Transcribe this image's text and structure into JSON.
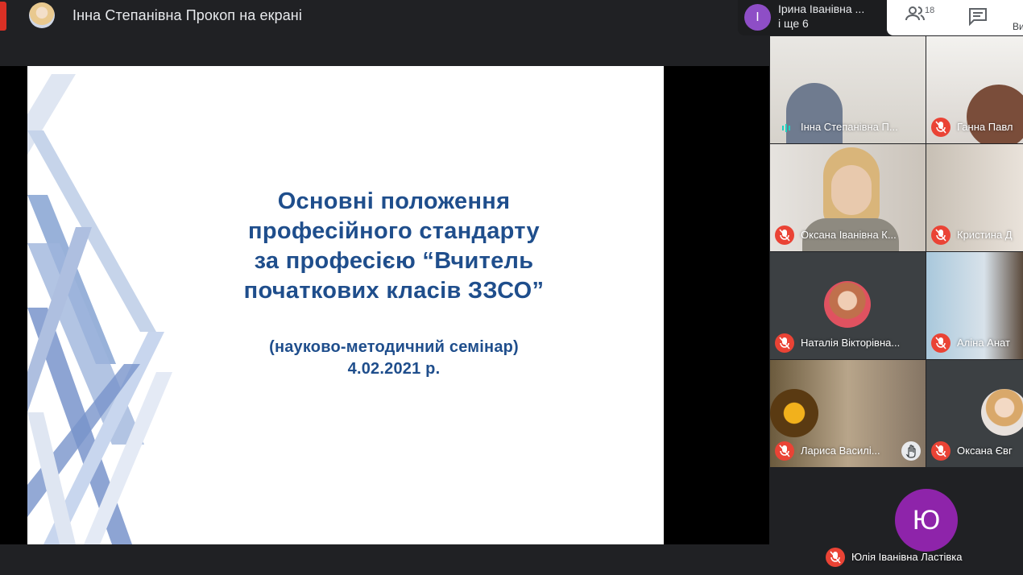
{
  "header": {
    "presenter_title": "Інна Степанівна Прокоп на екрані"
  },
  "participant_chip": {
    "avatar_letter": "І",
    "name": "Ірина Іванівна ...",
    "more": "і ще 6"
  },
  "right_panel": {
    "people_count": "18",
    "label": "Ви"
  },
  "slide": {
    "title_lines": [
      "Основні положення",
      "професійного стандарту",
      "за професією “Вчитель",
      "початкових класів ЗЗСО”"
    ],
    "subtitle": "(науково-методичний семінар)",
    "date": "4.02.2021 р."
  },
  "tiles": [
    {
      "name": "Інна Степанівна П...",
      "state": "speaking"
    },
    {
      "name": "Ганна Павл",
      "state": "muted"
    },
    {
      "name": "Оксана Іванівна К...",
      "state": "muted"
    },
    {
      "name": "Кристина Д",
      "state": "muted"
    },
    {
      "name": "Наталія Вікторівна...",
      "state": "muted"
    },
    {
      "name": "Аліна Анат",
      "state": "muted"
    },
    {
      "name": "Лариса Василі...",
      "state": "muted",
      "hand": true
    },
    {
      "name": "Оксана Євг",
      "state": "muted"
    },
    {
      "name": "Юлія Іванівна Ластівка",
      "state": "muted",
      "avatar_letter": "Ю"
    }
  ],
  "colors": {
    "slide_text": "#1f4e8c",
    "mic_off": "#ea4335",
    "chip_avatar": "#8e4ec6",
    "big_avatar": "#8e24aa"
  }
}
